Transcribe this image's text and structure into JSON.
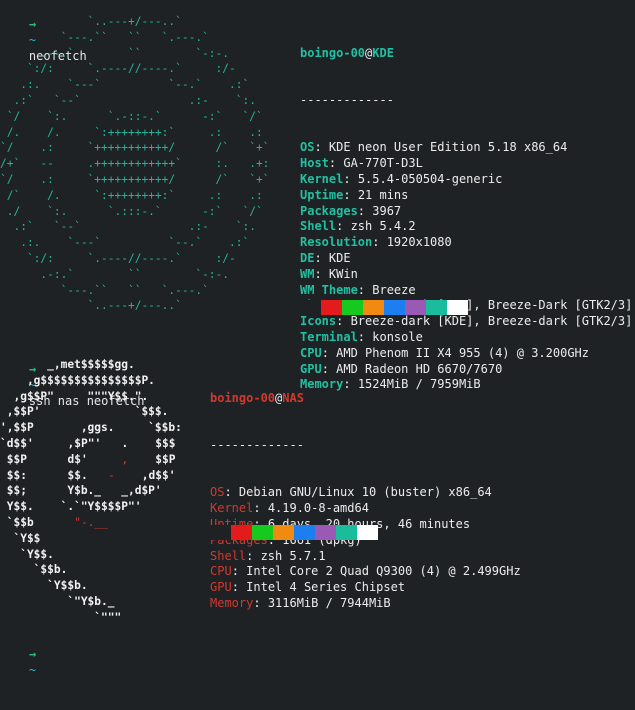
{
  "prompts": [
    {
      "arrow": "→",
      "dir": "~",
      "command": "neofetch"
    },
    {
      "arrow": "→",
      "dir": "~",
      "command": "ssh nas neofetch"
    },
    {
      "arrow": "→",
      "dir": "~",
      "command": ""
    }
  ],
  "kde": {
    "ascii_art": "             `..---+/---..`\n         `---.``   ``   `.---.`\n      .--.`        ``        `-:-.\n    `:/:     `.----//----.`     :/-\n   .:.    `---`          `--.`    .:`\n  .:`   `--`                .:-    `:.\n `/    `:.      `.-::-.`      -:`   `/`\n /.    /.     `:++++++++:`     .:    .:\n`/    .:     `+++++++++++/      /`   `+`\n/+`   --     .++++++++++++`     :.   .+:\n`/    .:     `+++++++++++/      /`   `+`\n /`    /.     `:++++++++:`     .:    .:\n ./    `:.      `.:::-.`      -:`   `/`\n  .:`   `--`                .:-    `:.\n   .:.    `---`          `--.`    .:`\n    `:/:     `.----//----.`     :/-\n      .-:.`        ``        `-:-.\n         `---.``   ``   `.---.`\n             `..---+/---..`",
    "user": "boingo-00",
    "at": "@",
    "host": "KDE",
    "separator": "-------------",
    "fields": [
      {
        "key": "OS",
        "value": "KDE neon User Edition 5.18 x86_64"
      },
      {
        "key": "Host",
        "value": "GA-770T-D3L"
      },
      {
        "key": "Kernel",
        "value": "5.5.4-050504-generic"
      },
      {
        "key": "Uptime",
        "value": "21 mins"
      },
      {
        "key": "Packages",
        "value": "3967"
      },
      {
        "key": "Shell",
        "value": "zsh 5.4.2"
      },
      {
        "key": "Resolution",
        "value": "1920x1080"
      },
      {
        "key": "DE",
        "value": "KDE"
      },
      {
        "key": "WM",
        "value": "KWin"
      },
      {
        "key": "WM Theme",
        "value": "Breeze"
      },
      {
        "key": "Theme",
        "value": "Breeze Dark [KDE], Breeze-Dark [GTK2/3]"
      },
      {
        "key": "Icons",
        "value": "Breeze-dark [KDE], Breeze-dark [GTK2/3]"
      },
      {
        "key": "Terminal",
        "value": "konsole"
      },
      {
        "key": "CPU",
        "value": "AMD Phenom II X4 955 (4) @ 3.200GHz"
      },
      {
        "key": "GPU",
        "value": "AMD Radeon HD 6670/7670"
      },
      {
        "key": "Memory",
        "value": "1524MiB / 7959MiB"
      }
    ],
    "palette": [
      "#1f2225",
      "#e31b1b",
      "#15c91f",
      "#f08a10",
      "#1d7ef0",
      "#9b59b6",
      "#1abc9c",
      "#ffffff"
    ]
  },
  "debian": {
    "ascii_art_lines": [
      "       _,met$$$$$gg.",
      "    ,g$$$$$$$$$$$$$$$P.",
      "  ,g$$P\"     \"\"\"Y$$.\".",
      " ,$$P'              `$$$.",
      "',$$P       ,ggs.     `$$b:",
      "`d$$'     ,$P\"'   .    $$$",
      " $$P      d$'     ,    $$P",
      " $$:      $$.   -    ,d$$'",
      " $$;      Y$b._   _,d$P'",
      " Y$$.    `.`\"Y$$$$P\"'",
      " `$$b      \"-.__",
      "  `Y$$",
      "   `Y$$.",
      "     `$$b.",
      "       `Y$$b.",
      "          `\"Y$b._",
      "              `\"\"\""
    ],
    "user": "boingo-00",
    "at": "@",
    "host": "NAS",
    "separator": "-------------",
    "fields": [
      {
        "key": "OS",
        "value": "Debian GNU/Linux 10 (buster) x86_64"
      },
      {
        "key": "Kernel",
        "value": "4.19.0-8-amd64"
      },
      {
        "key": "Uptime",
        "value": "6 days, 20 hours, 46 minutes"
      },
      {
        "key": "Packages",
        "value": "1661 (dpkg)"
      },
      {
        "key": "Shell",
        "value": "zsh 5.7.1"
      },
      {
        "key": "CPU",
        "value": "Intel Core 2 Quad Q9300 (4) @ 2.499GHz"
      },
      {
        "key": "GPU",
        "value": "Intel 4 Series Chipset"
      },
      {
        "key": "Memory",
        "value": "3116MiB / 7944MiB"
      }
    ],
    "palette": [
      "#1f2225",
      "#e31b1b",
      "#15c91f",
      "#f08a10",
      "#1d7ef0",
      "#9b59b6",
      "#1abc9c",
      "#ffffff"
    ]
  },
  "colors": {
    "background": "#1f2225",
    "prompt_arrow": "#20c27a",
    "prompt_dir": "#22b8d0",
    "kde_accent": "#22c0a2",
    "debian_accent": "#d1392f"
  }
}
